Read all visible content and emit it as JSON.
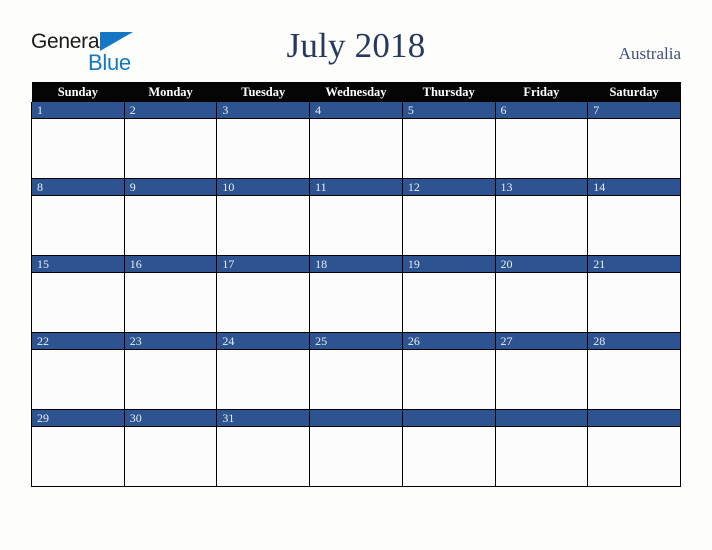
{
  "brand": {
    "name_part1": "General",
    "name_part2": "Blue",
    "triangle_icon": "triangle-icon",
    "color_dark": "#1b1b1b",
    "color_blue": "#1477c4"
  },
  "header": {
    "title": "July 2018",
    "region": "Australia",
    "title_color": "#27395e",
    "region_color": "#3f5079"
  },
  "calendar": {
    "weekday_headers": [
      "Sunday",
      "Monday",
      "Tuesday",
      "Wednesday",
      "Thursday",
      "Friday",
      "Saturday"
    ],
    "header_bg": "#050505",
    "header_text_color": "#ffffff",
    "daynum_bg": "#2d5490",
    "daynum_text_color": "#e8ecf4",
    "cell_bg": "#fcfcfc",
    "grid_line_color": "#000000",
    "weeks": [
      [
        {
          "day": "1",
          "events": ""
        },
        {
          "day": "2",
          "events": ""
        },
        {
          "day": "3",
          "events": ""
        },
        {
          "day": "4",
          "events": ""
        },
        {
          "day": "5",
          "events": ""
        },
        {
          "day": "6",
          "events": ""
        },
        {
          "day": "7",
          "events": ""
        }
      ],
      [
        {
          "day": "8",
          "events": ""
        },
        {
          "day": "9",
          "events": ""
        },
        {
          "day": "10",
          "events": ""
        },
        {
          "day": "11",
          "events": ""
        },
        {
          "day": "12",
          "events": ""
        },
        {
          "day": "13",
          "events": ""
        },
        {
          "day": "14",
          "events": ""
        }
      ],
      [
        {
          "day": "15",
          "events": ""
        },
        {
          "day": "16",
          "events": ""
        },
        {
          "day": "17",
          "events": ""
        },
        {
          "day": "18",
          "events": ""
        },
        {
          "day": "19",
          "events": ""
        },
        {
          "day": "20",
          "events": ""
        },
        {
          "day": "21",
          "events": ""
        }
      ],
      [
        {
          "day": "22",
          "events": ""
        },
        {
          "day": "23",
          "events": ""
        },
        {
          "day": "24",
          "events": ""
        },
        {
          "day": "25",
          "events": ""
        },
        {
          "day": "26",
          "events": ""
        },
        {
          "day": "27",
          "events": ""
        },
        {
          "day": "28",
          "events": ""
        }
      ],
      [
        {
          "day": "29",
          "events": ""
        },
        {
          "day": "30",
          "events": ""
        },
        {
          "day": "31",
          "events": ""
        },
        {
          "day": "",
          "events": ""
        },
        {
          "day": "",
          "events": ""
        },
        {
          "day": "",
          "events": ""
        },
        {
          "day": "",
          "events": ""
        }
      ]
    ]
  },
  "page": {
    "background": "#fdfdfb"
  }
}
